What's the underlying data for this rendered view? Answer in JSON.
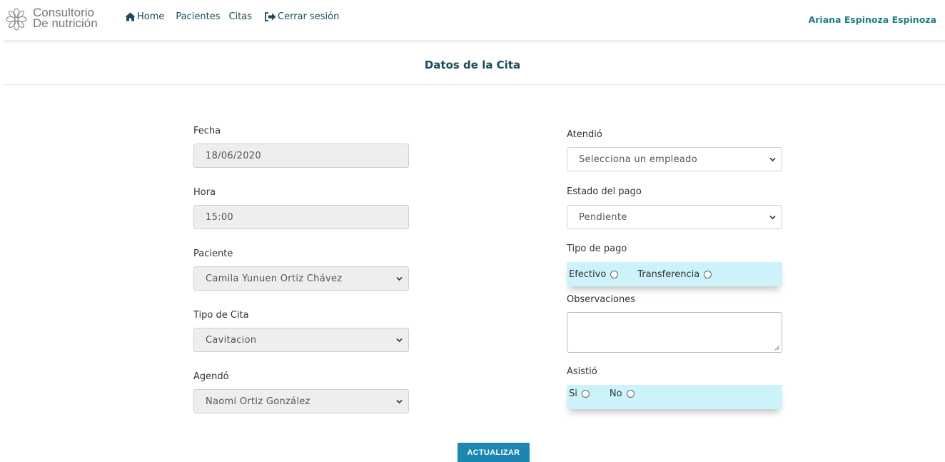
{
  "brand": {
    "line1": "Consultorio",
    "line2": "De nutrición"
  },
  "nav": {
    "home": "Home",
    "pacientes": "Pacientes",
    "citas": "Citas",
    "logout": "Cerrar sesión"
  },
  "user": {
    "name": "Ariana Espinoza Espinoza"
  },
  "page": {
    "title": "Datos de la Cita"
  },
  "form": {
    "fecha": {
      "label": "Fecha",
      "value": "18/06/2020"
    },
    "hora": {
      "label": "Hora",
      "value": "15:00"
    },
    "paciente": {
      "label": "Paciente",
      "value": "Camila Yunuen Ortiz Chávez"
    },
    "tipo_cita": {
      "label": "Tipo de Cita",
      "value": "Cavitacion"
    },
    "agendo": {
      "label": "Agendó",
      "value": "Naomi Ortiz González"
    },
    "atendio": {
      "label": "Atendió",
      "value": "Selecciona un empleado"
    },
    "estado_pago": {
      "label": "Estado del pago",
      "value": "Pendiente"
    },
    "tipo_pago": {
      "label": "Tipo de pago",
      "option1": "Efectivo",
      "option2": "Transferencia"
    },
    "observaciones": {
      "label": "Observaciones",
      "value": ""
    },
    "asistio": {
      "label": "Asistió",
      "option1": "Si",
      "option2": "No"
    }
  },
  "actions": {
    "update": "ACTUALIZAR"
  },
  "colors": {
    "accent": "#1f7d85",
    "nav_text": "#1b4a5a",
    "button": "#1d86b0",
    "radio_bg": "#cbf3f9"
  }
}
